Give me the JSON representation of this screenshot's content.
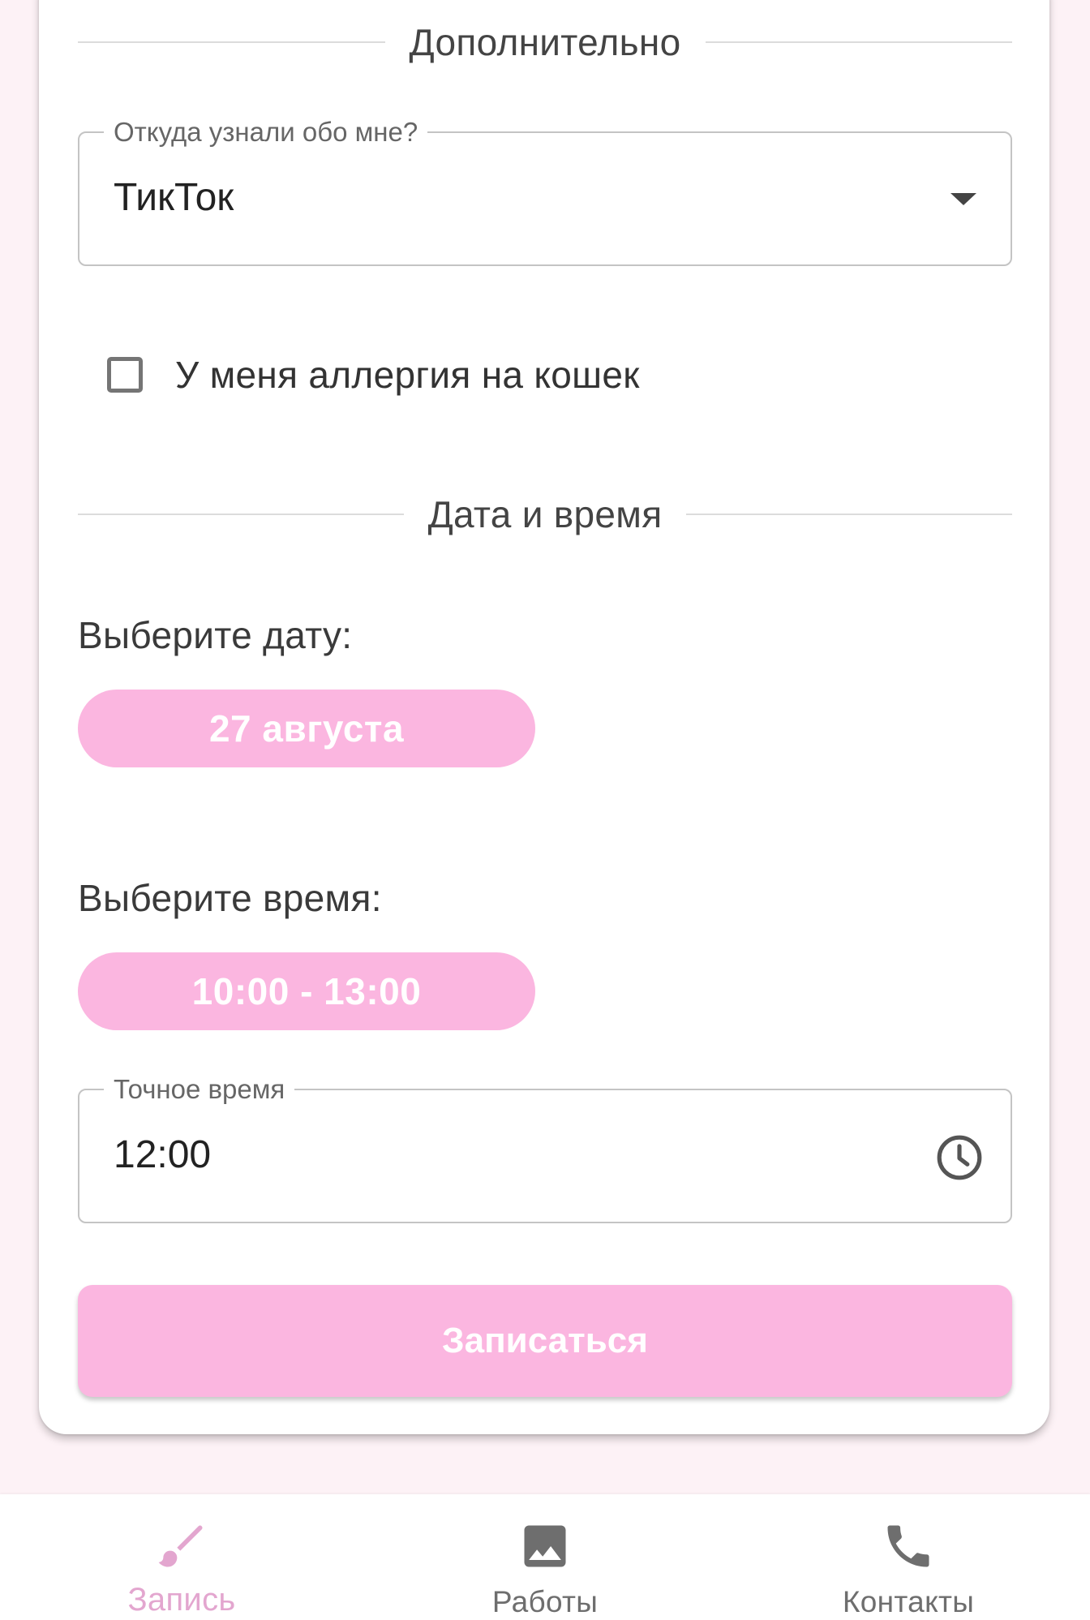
{
  "colors": {
    "accent": "#fbb6e0",
    "active_nav": "#e3a6cf",
    "background": "#fdf2f6"
  },
  "sections": {
    "additional_title": "Дополнительно",
    "datetime_title": "Дата и время"
  },
  "source_field": {
    "label": "Откуда узнали обо мне?",
    "value": "ТикТок",
    "icon": "dropdown-arrow-icon"
  },
  "allergy_checkbox": {
    "label": "У меня аллергия на кошек",
    "checked": false
  },
  "date_picker": {
    "label": "Выберите дату:",
    "selected": "27 августа"
  },
  "time_picker": {
    "label": "Выберите время:",
    "selected": "10:00 - 13:00"
  },
  "exact_time_field": {
    "label": "Точное время",
    "value": "12:00",
    "icon": "clock-icon"
  },
  "submit_label": "Записаться",
  "bottom_nav": {
    "items": [
      {
        "label": "Запись",
        "icon": "brush-icon",
        "active": true
      },
      {
        "label": "Работы",
        "icon": "image-icon",
        "active": false
      },
      {
        "label": "Контакты",
        "icon": "phone-icon",
        "active": false
      }
    ]
  }
}
